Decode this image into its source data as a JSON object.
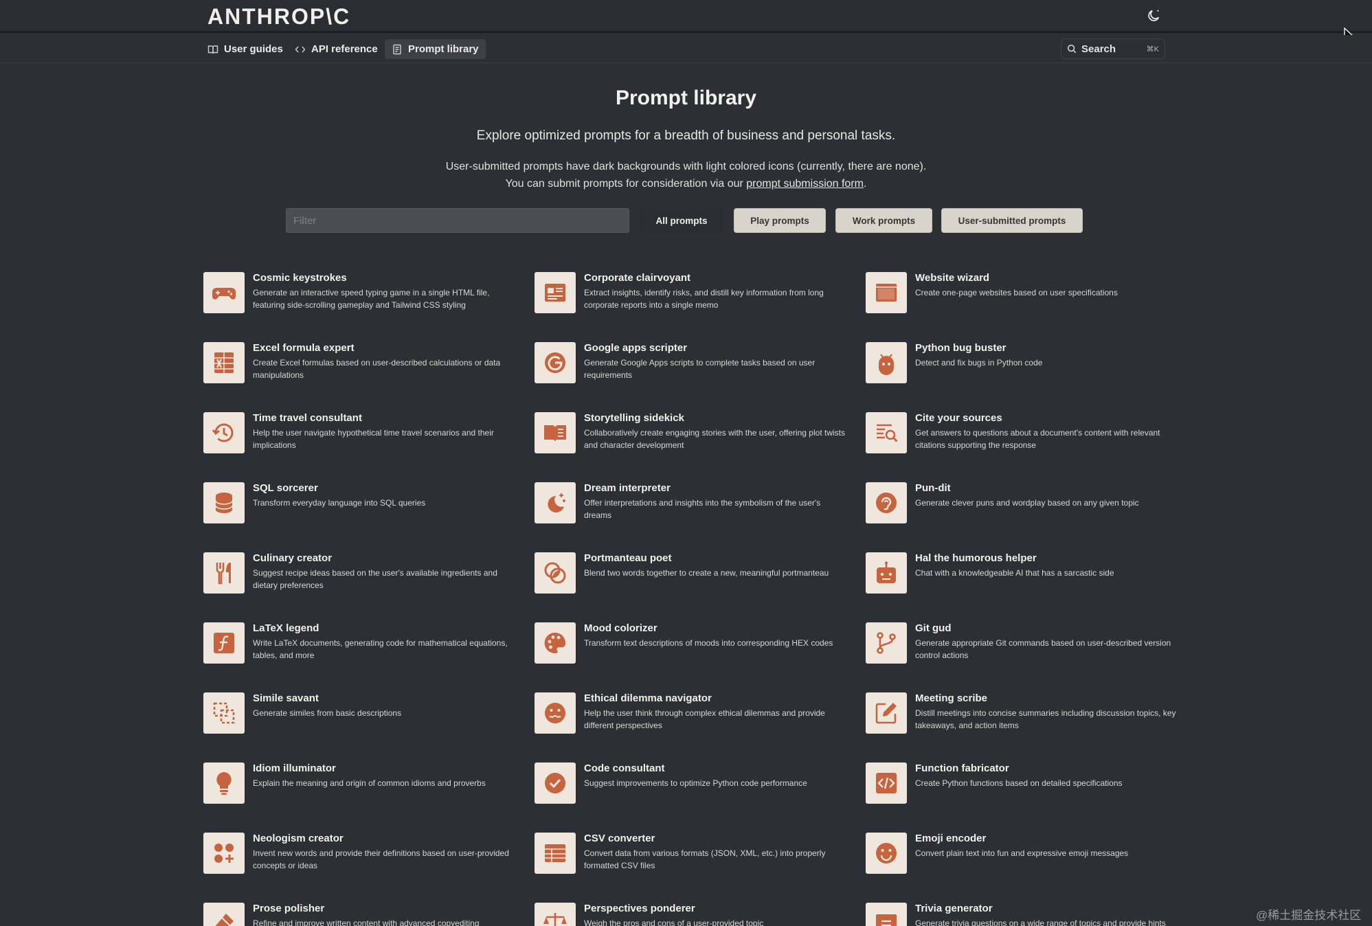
{
  "header": {
    "logo": "ANTHROP\\C"
  },
  "nav": {
    "items": [
      {
        "label": "User guides"
      },
      {
        "label": "API reference"
      },
      {
        "label": "Prompt library"
      }
    ],
    "search": {
      "label": "Search",
      "shortcut": "⌘K"
    }
  },
  "main": {
    "title": "Prompt library",
    "subtitle": "Explore optimized prompts for a breadth of business and personal tasks.",
    "note_line1": "User-submitted prompts have dark backgrounds with light colored icons (currently, there are none).",
    "note_line2_prefix": "You can submit prompts for consideration via our ",
    "note_link": "prompt submission form",
    "note_line2_suffix": ".",
    "filter_placeholder": "Filter",
    "filters": [
      "All prompts",
      "Play prompts",
      "Work prompts",
      "User-submitted prompts"
    ]
  },
  "colors": {
    "icon_bg": "#efe7dd",
    "icon_fg": "#c5643f",
    "page_bg": "#2c3034"
  },
  "prompts": [
    {
      "title": "Cosmic keystrokes",
      "desc": "Generate an interactive speed typing game in a single HTML file, featuring side-scrolling gameplay and Tailwind CSS styling",
      "icon": "gamepad-icon"
    },
    {
      "title": "Corporate clairvoyant",
      "desc": "Extract insights, identify risks, and distill key information from long corporate reports into a single memo",
      "icon": "report-icon"
    },
    {
      "title": "Website wizard",
      "desc": "Create one-page websites based on user specifications",
      "icon": "browser-window-icon"
    },
    {
      "title": "Excel formula expert",
      "desc": "Create Excel formulas based on user-described calculations or data manipulations",
      "icon": "spreadsheet-icon"
    },
    {
      "title": "Google apps scripter",
      "desc": "Generate Google Apps scripts to complete tasks based on user requirements",
      "icon": "google-icon"
    },
    {
      "title": "Python bug buster",
      "desc": "Detect and fix bugs in Python code",
      "icon": "bug-icon"
    },
    {
      "title": "Time travel consultant",
      "desc": "Help the user navigate hypothetical time travel scenarios and their implications",
      "icon": "clock-rewind-icon"
    },
    {
      "title": "Storytelling sidekick",
      "desc": "Collaboratively create engaging stories with the user, offering plot twists and character development",
      "icon": "open-book-icon"
    },
    {
      "title": "Cite your sources",
      "desc": "Get answers to questions about a document's content with relevant citations supporting the response",
      "icon": "document-search-icon"
    },
    {
      "title": "SQL sorcerer",
      "desc": "Transform everyday language into SQL queries",
      "icon": "database-icon"
    },
    {
      "title": "Dream interpreter",
      "desc": "Offer interpretations and insights into the symbolism of the user's dreams",
      "icon": "moon-stars-icon"
    },
    {
      "title": "Pun-dit",
      "desc": "Generate clever puns and wordplay based on any given topic",
      "icon": "ear-icon"
    },
    {
      "title": "Culinary creator",
      "desc": "Suggest recipe ideas based on the user's available ingredients and dietary preferences",
      "icon": "fork-knife-icon"
    },
    {
      "title": "Portmanteau poet",
      "desc": "Blend two words together to create a new, meaningful portmanteau",
      "icon": "overlapping-circles-icon"
    },
    {
      "title": "Hal the humorous helper",
      "desc": "Chat with a knowledgeable AI that has a sarcastic side",
      "icon": "robot-icon"
    },
    {
      "title": "LaTeX legend",
      "desc": "Write LaTeX documents, generating code for mathematical equations, tables, and more",
      "icon": "function-icon"
    },
    {
      "title": "Mood colorizer",
      "desc": "Transform text descriptions of moods into corresponding HEX codes",
      "icon": "palette-icon"
    },
    {
      "title": "Git gud",
      "desc": "Generate appropriate Git commands based on user-described version control actions",
      "icon": "git-branch-icon"
    },
    {
      "title": "Simile savant",
      "desc": "Generate similes from basic descriptions",
      "icon": "dashed-squares-icon"
    },
    {
      "title": "Ethical dilemma navigator",
      "desc": "Help the user think through complex ethical dilemmas and provide different perspectives",
      "icon": "uneasy-face-icon"
    },
    {
      "title": "Meeting scribe",
      "desc": "Distill meetings into concise summaries including discussion topics, key takeaways, and action items",
      "icon": "pencil-square-icon"
    },
    {
      "title": "Idiom illuminator",
      "desc": "Explain the meaning and origin of common idioms and proverbs",
      "icon": "lightbulb-icon"
    },
    {
      "title": "Code consultant",
      "desc": "Suggest improvements to optimize Python code performance",
      "icon": "check-circle-icon"
    },
    {
      "title": "Function fabricator",
      "desc": "Create Python functions based on detailed specifications",
      "icon": "code-brackets-icon"
    },
    {
      "title": "Neologism creator",
      "desc": "Invent new words and provide their definitions based on user-provided concepts or ideas",
      "icon": "shapes-plus-icon"
    },
    {
      "title": "CSV converter",
      "desc": "Convert data from various formats (JSON, XML, etc.) into properly formatted CSV files",
      "icon": "table-icon"
    },
    {
      "title": "Emoji encoder",
      "desc": "Convert plain text into fun and expressive emoji messages",
      "icon": "smiley-icon"
    },
    {
      "title": "Prose polisher",
      "desc": "Refine and improve written content with advanced copyediting",
      "icon": "eraser-icon"
    },
    {
      "title": "Perspectives ponderer",
      "desc": "Weigh the pros and cons of a user-provided topic",
      "icon": "scale-icon"
    },
    {
      "title": "Trivia generator",
      "desc": "Generate trivia questions on a wide range of topics and provide hints",
      "icon": "card-icon"
    }
  ],
  "watermark": "@稀土掘金技术社区"
}
